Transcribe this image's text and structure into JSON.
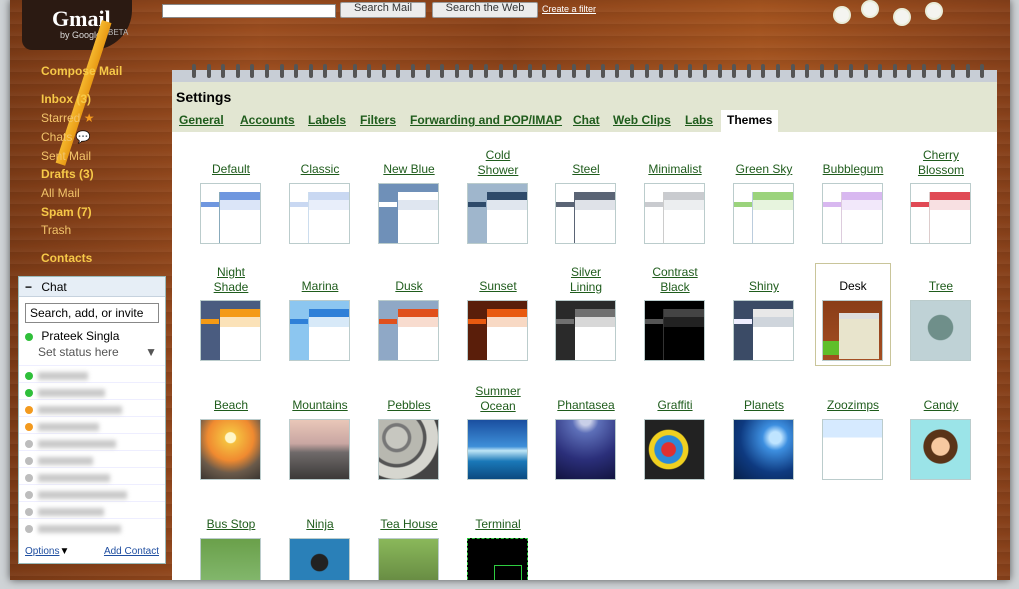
{
  "header": {
    "logo": "Gmail",
    "logo_sub": "by Google",
    "logo_beta": "BETA",
    "search_mail_button": "Search Mail",
    "search_web_button": "Search the Web",
    "create_filter_link": "Create a filter"
  },
  "nav": {
    "compose": "Compose Mail",
    "inbox": "Inbox (3)",
    "starred": "Starred",
    "chats": "Chats",
    "sent": "Sent Mail",
    "drafts": "Drafts (3)",
    "all": "All Mail",
    "spam": "Spam (7)",
    "trash": "Trash",
    "contacts": "Contacts"
  },
  "chat": {
    "title": "Chat",
    "collapse": "−",
    "search_placeholder": "Search, add, or invite",
    "me": "Prateek Singla",
    "status": "Set status here",
    "options": "Options",
    "add_contact": "Add Contact",
    "contact_dots": [
      "#2fbf3a",
      "#2fbf3a",
      "#f39a1e",
      "#f39a1e",
      "#bdbdbd",
      "#bdbdbd",
      "#bdbdbd",
      "#bdbdbd",
      "#bdbdbd",
      "#bdbdbd"
    ]
  },
  "settings": {
    "title": "Settings",
    "tabs": {
      "general": "General",
      "accounts": "Accounts",
      "labels": "Labels",
      "filters": "Filters",
      "forwarding": "Forwarding and POP/IMAP",
      "chat": "Chat",
      "webclips": "Web Clips",
      "labs": "Labs",
      "themes": "Themes"
    },
    "themes": {
      "default": "Default",
      "classic": "Classic",
      "newblue": "New Blue",
      "coldshower": "Cold Shower",
      "steel": "Steel",
      "minimalist": "Minimalist",
      "greensky": "Green Sky",
      "bubblegum": "Bubblegum",
      "cherry": "Cherry Blossom",
      "nightshade": "Night Shade",
      "marina": "Marina",
      "dusk": "Dusk",
      "sunset": "Sunset",
      "silver": "Silver Lining",
      "contrast": "Contrast Black",
      "shiny": "Shiny",
      "desk": "Desk",
      "tree": "Tree",
      "beach": "Beach",
      "mountains": "Mountains",
      "pebbles": "Pebbles",
      "summer": "Summer Ocean",
      "phantasea": "Phantasea",
      "graffiti": "Graffiti",
      "planets": "Planets",
      "zoozimps": "Zoozimps",
      "candy": "Candy",
      "busstop": "Bus Stop",
      "ninja": "Ninja",
      "teahouse": "Tea House",
      "terminal": "Terminal"
    },
    "selected_theme": "Desk"
  }
}
